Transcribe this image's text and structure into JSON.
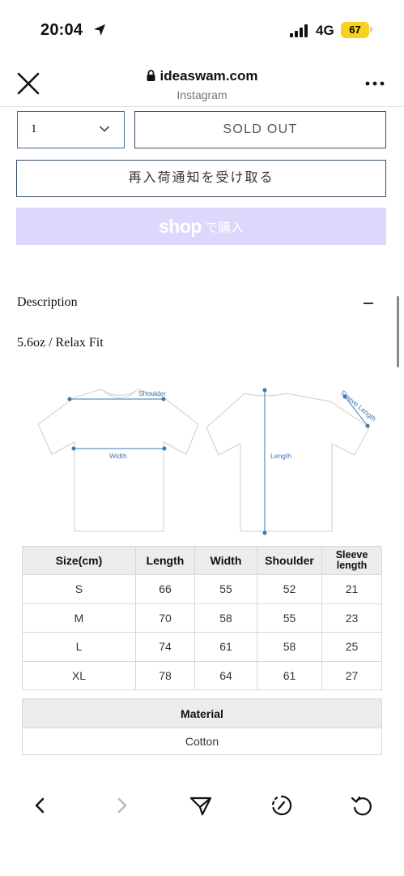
{
  "status_bar": {
    "time": "20:04",
    "network": "4G",
    "battery": "67"
  },
  "browser": {
    "url": "ideaswam.com",
    "source": "Instagram"
  },
  "product": {
    "quantity": "1",
    "sold_out_label": "SOLD OUT",
    "restock_label": "再入荷通知を受け取る",
    "shop_pay_logo": "shop",
    "shop_pay_text": "で購入"
  },
  "description": {
    "label": "Description",
    "fit": "5.6oz / Relax Fit"
  },
  "diagram_labels": {
    "shoulder": "Shoulder",
    "width": "Width",
    "length": "Length",
    "sleeve": "Sleeve Length"
  },
  "size_table": {
    "headers": [
      "Size(cm)",
      "Length",
      "Width",
      "Shoulder",
      "Sleeve",
      "length"
    ],
    "rows": [
      [
        "S",
        "66",
        "55",
        "52",
        "21"
      ],
      [
        "M",
        "70",
        "58",
        "55",
        "23"
      ],
      [
        "L",
        "74",
        "61",
        "58",
        "25"
      ],
      [
        "XL",
        "78",
        "64",
        "61",
        "27"
      ]
    ]
  },
  "material_table": {
    "header": "Material",
    "value": "Cotton"
  },
  "icons": {
    "location": "location-arrow-icon",
    "signal": "signal-bars-icon",
    "close": "close-icon",
    "lock": "lock-icon",
    "more": "more-icon",
    "chevron": "chevron-down-icon",
    "back": "back-icon",
    "forward": "forward-icon",
    "share": "share-icon",
    "reload": "reload-icon"
  },
  "colors": {
    "shop_pay_bg": "#dcd7fb",
    "battery": "#f7d21c",
    "diagram_accent": "#3a79b8",
    "button_border": "#3c5068"
  }
}
